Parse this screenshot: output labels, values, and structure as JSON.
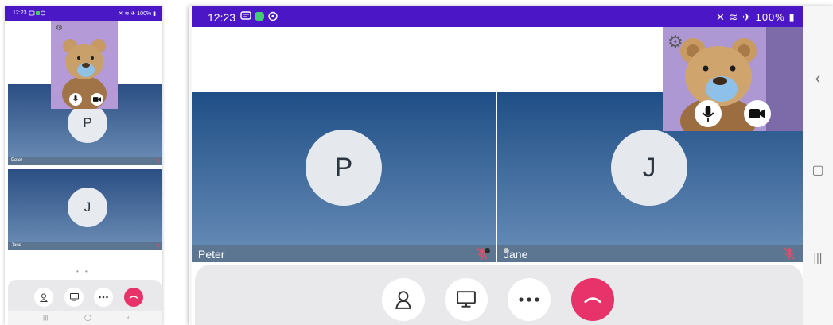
{
  "status_bar": {
    "time": "12:23",
    "battery": "100%"
  },
  "small_status_bar": {
    "time": "12:23",
    "battery": "100%"
  },
  "participants": [
    {
      "name": "Peter",
      "initial": "P",
      "muted": true
    },
    {
      "name": "Jane",
      "initial": "J",
      "muted": true
    }
  ],
  "pager": {
    "pages": 2,
    "current": 1
  },
  "toolbar": [
    {
      "name": "participants",
      "icon": "person-icon"
    },
    {
      "name": "share-screen",
      "icon": "monitor-icon"
    },
    {
      "name": "more",
      "icon": "more-icon"
    },
    {
      "name": "hang-up",
      "icon": "hang-up-icon"
    }
  ],
  "self_view": {
    "mic_on": true,
    "camera_on": true
  },
  "nav_bar": {
    "icons": [
      "back-icon",
      "home-icon",
      "recents-icon"
    ]
  },
  "colors": {
    "status_bar": "#4b16c6",
    "tile_gradient_top": "#1f4e86",
    "tile_gradient_bottom": "#6a8fb9",
    "name_bar": "#5c7590",
    "hang_up": "#e8336a",
    "mute_icon": "#d9506e",
    "toolbar_bg": "#e9e9eb",
    "self_view_bg": "#a994cf"
  }
}
